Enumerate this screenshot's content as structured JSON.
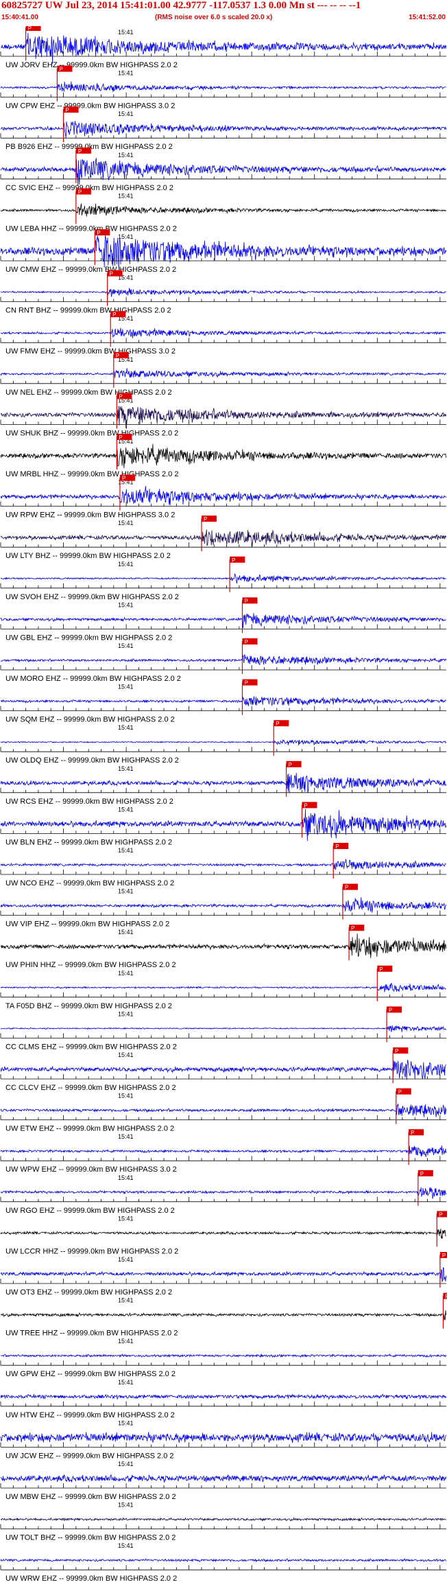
{
  "header": {
    "title": "60825727 UW Jul 23, 2014 15:41:01.00   42.9777 -117.0537  1.3 0.00 Mn st --- -- -- --1",
    "start_time": "15:40:41.00",
    "rms_note": "(RMS noise over 6.0 s scaled 20.0 x)",
    "end_time": "15:41:52.00"
  },
  "colors": {
    "trace_blue": "#0000ee",
    "trace_dark": "#1a0a50",
    "trace_black": "#000000",
    "pick": "#dd0000",
    "text": "#000000",
    "header_text": "#e00000"
  },
  "chart_data": {
    "type": "seismogram",
    "x_unit": "time",
    "xlim": [
      "15:40:41.00",
      "15:41:52.00"
    ],
    "tick_label": "15:41",
    "pick_label": "P",
    "traces": [
      {
        "label": "UW JORV EHZ -- 99999.0km BW  HIGHPASS  2.0  2",
        "color": "blue",
        "pick_s": 4.0,
        "amplitude": 0.8,
        "grid": true
      },
      {
        "label": "UW CPW EHZ -- 99999.0km BW  HIGHPASS  3.0  2",
        "color": "blue",
        "pick_s": 9.0,
        "amplitude": 0.25,
        "grid": true
      },
      {
        "label": "PB B926 EHZ -- 99999.0km BW  HIGHPASS  2.0  2",
        "color": "blue",
        "pick_s": 10.0,
        "amplitude": 0.4,
        "grid": true
      },
      {
        "label": "CC SVIC EHZ -- 99999.0km BW  HIGHPASS  2.0  2",
        "color": "blue",
        "pick_s": 12.0,
        "amplitude": 0.6,
        "grid": true
      },
      {
        "label": "UW LEBA HHZ -- 99999.0km BW  HIGHPASS  2.0  2",
        "color": "black",
        "pick_s": 12.0,
        "amplitude": 0.3,
        "grid": false
      },
      {
        "label": "UW CMW EHZ -- 99999.0km BW  HIGHPASS  2.0  2",
        "color": "blue",
        "pick_s": 15.0,
        "amplitude": 1.0,
        "grid": true
      },
      {
        "label": "CN RNT BHZ -- 99999.0km BW  HIGHPASS  2.0  2",
        "color": "blue",
        "pick_s": 17.0,
        "amplitude": 0.2,
        "grid": true
      },
      {
        "label": "UW FMW EHZ -- 99999.0km BW  HIGHPASS  3.0  2",
        "color": "blue",
        "pick_s": 17.5,
        "amplitude": 0.25,
        "grid": true
      },
      {
        "label": "UW NEL EHZ -- 99999.0km BW  HIGHPASS  2.0  2",
        "color": "blue",
        "pick_s": 18.0,
        "amplitude": 0.25,
        "grid": true
      },
      {
        "label": "UW SHUK BHZ -- 99999.0km BW  HIGHPASS  2.0  2",
        "color": "dark",
        "pick_s": 18.5,
        "amplitude": 0.55,
        "grid": true
      },
      {
        "label": "UW MRBL HHZ -- 99999.0km BW  HIGHPASS  2.0  2",
        "color": "black",
        "pick_s": 18.5,
        "amplitude": 0.6,
        "grid": false
      },
      {
        "label": "UW RPW EHZ -- 99999.0km BW  HIGHPASS  3.0  2",
        "color": "blue",
        "pick_s": 19.0,
        "amplitude": 0.5,
        "grid": true
      },
      {
        "label": "UW LTY BHZ -- 99999.0km BW  HIGHPASS  2.0  2",
        "color": "dark",
        "pick_s": 32.0,
        "amplitude": 0.5,
        "grid": true
      },
      {
        "label": "UW SVOH EHZ -- 99999.0km BW  HIGHPASS  2.0  2",
        "color": "blue",
        "pick_s": 36.5,
        "amplitude": 0.2,
        "grid": true
      },
      {
        "label": "UW GBL EHZ -- 99999.0km BW  HIGHPASS  2.0  2",
        "color": "blue",
        "pick_s": 38.5,
        "amplitude": 0.35,
        "grid": true
      },
      {
        "label": "UW MORO EHZ -- 99999.0km BW  HIGHPASS  2.0  2",
        "color": "blue",
        "pick_s": 38.5,
        "amplitude": 0.3,
        "grid": true
      },
      {
        "label": "UW SQM EHZ -- 99999.0km BW  HIGHPASS  2.0  2",
        "color": "blue",
        "pick_s": 38.5,
        "amplitude": 0.3,
        "grid": true
      },
      {
        "label": "UW OLDQ EHZ -- 99999.0km BW  HIGHPASS  2.0  2",
        "color": "blue",
        "pick_s": 43.5,
        "amplitude": 0.15,
        "grid": true
      },
      {
        "label": "UW RCS EHZ -- 99999.0km BW  HIGHPASS  2.0  2",
        "color": "blue",
        "pick_s": 45.5,
        "amplitude": 0.5,
        "grid": true
      },
      {
        "label": "UW BLN EHZ -- 99999.0km BW  HIGHPASS  2.0  2",
        "color": "blue",
        "pick_s": 48.0,
        "amplitude": 0.7,
        "grid": true
      },
      {
        "label": "UW NCO EHZ -- 99999.0km BW  HIGHPASS  2.0  2",
        "color": "blue",
        "pick_s": 53.0,
        "amplitude": 0.3,
        "grid": true
      },
      {
        "label": "UW VIP EHZ -- 99999.0km BW  HIGHPASS  2.0  2",
        "color": "blue",
        "pick_s": 54.5,
        "amplitude": 0.35,
        "grid": true
      },
      {
        "label": "UW PHIN HHZ -- 99999.0km BW  HIGHPASS  2.0  2",
        "color": "black",
        "pick_s": 55.5,
        "amplitude": 0.55,
        "grid": false
      },
      {
        "label": "TA F05D BHZ -- 99999.0km BW  HIGHPASS  2.0  2",
        "color": "blue",
        "pick_s": 60.0,
        "amplitude": 0.2,
        "grid": true
      },
      {
        "label": "CC CLMS EHZ -- 99999.0km BW  HIGHPASS  2.0  2",
        "color": "blue",
        "pick_s": 61.5,
        "amplitude": 0.15,
        "grid": true
      },
      {
        "label": "CC CLCV EHZ -- 99999.0km BW  HIGHPASS  2.0  2",
        "color": "blue",
        "pick_s": 62.5,
        "amplitude": 0.55,
        "grid": true
      },
      {
        "label": "UW ETW EHZ -- 99999.0km BW  HIGHPASS  2.0  2",
        "color": "blue",
        "pick_s": 63.0,
        "amplitude": 0.35,
        "grid": true
      },
      {
        "label": "UW WPW EHZ -- 99999.0km BW  HIGHPASS  3.0  2",
        "color": "blue",
        "pick_s": 65.0,
        "amplitude": 0.3,
        "grid": true
      },
      {
        "label": "UW RGO EHZ -- 99999.0km BW  HIGHPASS  2.0  2",
        "color": "blue",
        "pick_s": 66.5,
        "amplitude": 0.3,
        "grid": true
      },
      {
        "label": "UW LCCR HHZ -- 99999.0km BW  HIGHPASS  2.0  2",
        "color": "black",
        "pick_s": 69.5,
        "amplitude": 0.3,
        "grid": false
      },
      {
        "label": "UW OT3 EHZ -- 99999.0km BW  HIGHPASS  2.0  2",
        "color": "blue",
        "pick_s": 70.0,
        "amplitude": 0.45,
        "grid": true
      },
      {
        "label": "UW TREE HHZ -- 99999.0km BW  HIGHPASS  2.0  2",
        "color": "black",
        "pick_s": 70.5,
        "amplitude": 0.35,
        "grid": false
      },
      {
        "label": "UW GPW EHZ -- 99999.0km BW  HIGHPASS  2.0  2",
        "color": "blue",
        "pick_s": null,
        "amplitude": 0.15,
        "grid": true
      },
      {
        "label": "UW HTW EHZ -- 99999.0km BW  HIGHPASS  2.0  2",
        "color": "blue",
        "pick_s": null,
        "amplitude": 0.25,
        "grid": true
      },
      {
        "label": "UW JCW EHZ -- 99999.0km BW  HIGHPASS  2.0  2",
        "color": "blue",
        "pick_s": null,
        "amplitude": 0.55,
        "grid": true
      },
      {
        "label": "UW MBW EHZ -- 99999.0km BW  HIGHPASS  2.0  2",
        "color": "blue",
        "pick_s": null,
        "amplitude": 0.4,
        "grid": true
      },
      {
        "label": "UW TOLT BHZ -- 99999.0km BW  HIGHPASS  2.0  2",
        "color": "dark",
        "pick_s": null,
        "amplitude": 0.15,
        "grid": true
      },
      {
        "label": "UW WRW EHZ -- 99999.0km BW  HIGHPASS  2.0  2",
        "color": "blue",
        "pick_s": null,
        "amplitude": 0.15,
        "grid": true
      }
    ]
  }
}
